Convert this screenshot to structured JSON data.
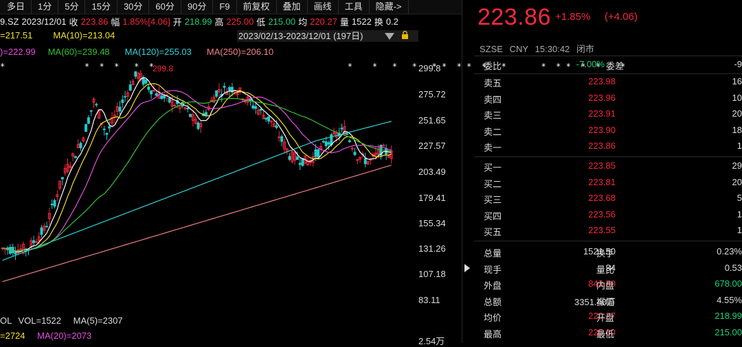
{
  "toolbar": [
    "多日",
    "1分",
    "5分",
    "15分",
    "30分",
    "60分",
    "90分",
    "F9",
    "前复权",
    "叠加",
    "画线",
    "工具",
    "隐藏->"
  ],
  "info": {
    "code": "9.SZ",
    "date": "2023/12/01",
    "close_label": "收",
    "close": "223.86",
    "amp_label": "幅",
    "amp": "1.85%[4.06]",
    "open_label": "开",
    "open": "218.99",
    "high_label": "高",
    "high": "225.00",
    "low_label": "低",
    "low": "215.00",
    "avg_label": "均",
    "avg": "220.27",
    "vol_label": "量",
    "vol": "1522",
    "turn_label": "换",
    "turn": "0.2"
  },
  "ma_row1": [
    {
      "text": "=217.51",
      "color": "#f2e02c"
    },
    {
      "text": "MA(10)=213.04",
      "color": "#f2e02c"
    }
  ],
  "ma_row2": [
    {
      "text": ")=222.99",
      "color": "#e84ee0"
    },
    {
      "text": "MA(60)=239.48",
      "color": "#35c232"
    },
    {
      "text": "MA(120)=255.03",
      "color": "#33d4d9"
    },
    {
      "text": "MA(250)=206.10",
      "color": "#f08080"
    }
  ],
  "range": "2023/02/13-2023/12/01 (197日)",
  "peak_label": "299.8",
  "stars": "*                *  *  *   *  *                                       *    *   *   *   * *  * *  *   *       *  * *  *  *    *",
  "yaxis": [
    "299.8",
    "275.72",
    "251.65",
    "227.57",
    "203.49",
    "179.41",
    "155.34",
    "131.26",
    "107.18",
    "83.11",
    "2.54万"
  ],
  "vol_row1": {
    "a": "OL",
    "b": "VOL=1522",
    "c": "MA(5)=2307"
  },
  "vol_row2": {
    "a": "=2724",
    "b": "MA(20)=2073"
  },
  "quote": {
    "price": "223.86",
    "chg_pct": "+1.85%",
    "chg_abs": "(+4.06)",
    "exchange": "SZSE",
    "currency": "CNY",
    "time": "15:30:42",
    "status": "闭市",
    "wb_label": "委比",
    "wb_val": "-7.00%",
    "wc_label": "委差",
    "wc_val": "-9",
    "asks": [
      {
        "label": "卖五",
        "price": "223.98",
        "vol": "16"
      },
      {
        "label": "卖四",
        "price": "223.96",
        "vol": "10"
      },
      {
        "label": "卖三",
        "price": "223.91",
        "vol": "20"
      },
      {
        "label": "卖二",
        "price": "223.90",
        "vol": "18"
      },
      {
        "label": "卖一",
        "price": "223.86",
        "vol": "1"
      }
    ],
    "bids": [
      {
        "label": "买一",
        "price": "223.85",
        "vol": "29"
      },
      {
        "label": "买二",
        "price": "223.81",
        "vol": "20"
      },
      {
        "label": "买三",
        "price": "223.68",
        "vol": "5"
      },
      {
        "label": "买四",
        "price": "223.56",
        "vol": "1"
      },
      {
        "label": "买五",
        "price": "223.55",
        "vol": "1"
      }
    ],
    "stats": [
      {
        "l1": "总量",
        "v1": "1521.50",
        "c1": "#ddd",
        "l2": "换手",
        "v2": "0.23%",
        "c2": "#ddd"
      },
      {
        "l1": "现手",
        "v1": "34",
        "c1": "#ddd",
        "l2": "量比",
        "v2": "0.53",
        "c2": "#ddd"
      },
      {
        "l1": "外盘",
        "v1": "843.50",
        "c1": "#f5293c",
        "l2": "内盘",
        "v2": "678.00",
        "c2": "#1fd27a"
      },
      {
        "l1": "总额",
        "v1": "3351.40万",
        "c1": "#ddd",
        "l2": "振幅",
        "v2": "4.55%",
        "c2": "#ddd"
      },
      {
        "l1": "均价",
        "v1": "220.27",
        "c1": "#f5293c",
        "l2": "开盘",
        "v2": "218.99",
        "c2": "#1fd27a"
      },
      {
        "l1": "最高",
        "v1": "225.00",
        "c1": "#f5293c",
        "l2": "最低",
        "v2": "215.00",
        "c2": "#1fd27a"
      }
    ]
  },
  "colors": {
    "up": "#f5293c",
    "down": "#1fd27a"
  }
}
